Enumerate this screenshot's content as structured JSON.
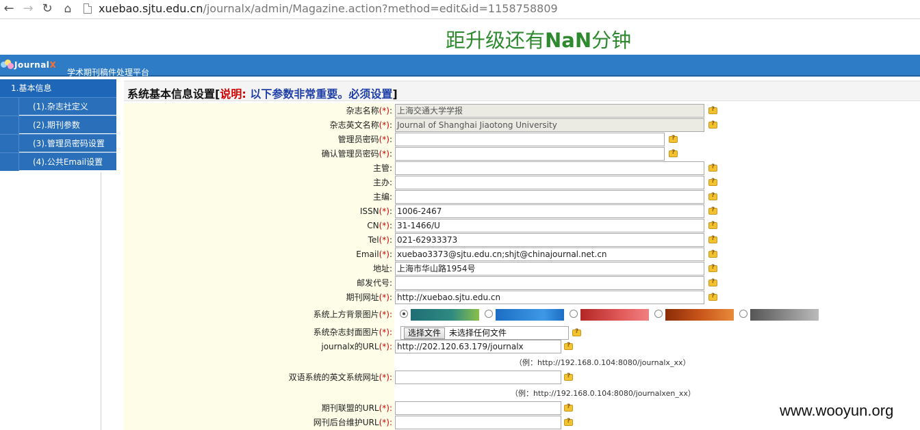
{
  "browser": {
    "url_host": "xuebao.sjtu.edu.cn",
    "url_path": "/journalx/admin/Magazine.action?method=edit&id=1158758809"
  },
  "countdown": {
    "prefix": "距升级还有",
    "value": "NaN",
    "suffix": "分钟"
  },
  "header": {
    "logo_main": "Journal",
    "logo_x": "X",
    "platform": "学术期刊稿件处理平台"
  },
  "sidebar": {
    "head": "1.基本信息",
    "items": [
      "(1).杂志社定义",
      "(2).期刊参数",
      "(3).管理员密码设置",
      "(4).公共Email设置"
    ]
  },
  "panel": {
    "title": "系统基本信息设置[",
    "note": "说明: ",
    "note2": "以下参数非常重要。必须设置",
    "close": "]"
  },
  "form": {
    "rows": [
      {
        "label": "杂志名称",
        "req": "(*)",
        "value": "上海交通大学学报",
        "readonly": true
      },
      {
        "label": "杂志英文名称",
        "req": "(*)",
        "value": "Journal of Shanghai Jiaotong University",
        "readonly": true
      },
      {
        "label": "管理员密码",
        "req": "(*)",
        "value": ""
      },
      {
        "label": "确认管理员密码",
        "req": "(*)",
        "value": ""
      },
      {
        "label": "主管",
        "req": "",
        "value": ""
      },
      {
        "label": "主办",
        "req": "",
        "value": ""
      },
      {
        "label": "主编",
        "req": "",
        "value": ""
      },
      {
        "label": "ISSN",
        "req": "(*)",
        "value": "1006-2467"
      },
      {
        "label": "CN",
        "req": "(*)",
        "value": "31-1466/U"
      },
      {
        "label": "Tel",
        "req": "(*)",
        "value": "021-62933373"
      },
      {
        "label": "Email",
        "req": "(*)",
        "value": "xuebao3373@sjtu.edu.cn;shjt@chinajournal.net.cn"
      },
      {
        "label": "地址",
        "req": "",
        "value": "上海市华山路1954号"
      },
      {
        "label": "邮发代号",
        "req": "",
        "value": ""
      },
      {
        "label": "期刊网址",
        "req": "(*)",
        "value": "http://xuebao.sjtu.edu.cn"
      }
    ],
    "bg_label": "系统上方背景图片",
    "bg_req": "(*):",
    "cover_label": "系统杂志封面图片",
    "cover_req": "(*):",
    "file_button": "选择文件",
    "file_status": "未选择任何文件",
    "journalx_label": "journalx的URL",
    "journalx_req": "(*):",
    "journalx_value": "http://202.120.63.179/journalx",
    "journalx_example": "（例：http://192.168.0.104:8080/journalx_xx）",
    "bilingual_label": "双语系统的英文系统网址",
    "bilingual_req": "(*):",
    "bilingual_example": "（例：http://192.168.0.104:8080/journalxen_xx）",
    "alliance_label": "期刊联盟的URL",
    "alliance_req": "(*):",
    "backend_label": "网刊后台维护URL",
    "backend_req": "(*):"
  },
  "watermark": "www.wooyun.org"
}
